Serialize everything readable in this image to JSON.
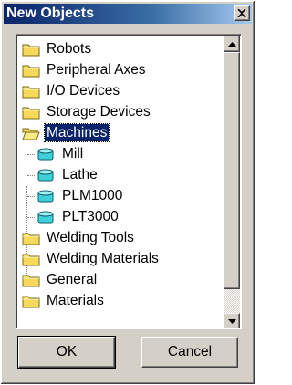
{
  "window": {
    "title": "New Objects"
  },
  "tree": {
    "items": [
      {
        "label": "Robots",
        "icon": "folder-icon"
      },
      {
        "label": "Peripheral Axes",
        "icon": "folder-icon"
      },
      {
        "label": "I/O Devices",
        "icon": "folder-icon"
      },
      {
        "label": "Storage Devices",
        "icon": "folder-icon"
      },
      {
        "label": "Machines",
        "icon": "open-folder-icon",
        "selected": true,
        "expanded": true
      },
      {
        "label": "Mill",
        "icon": "machine-icon",
        "child": true
      },
      {
        "label": "Lathe",
        "icon": "machine-icon",
        "child": true
      },
      {
        "label": "PLM1000",
        "icon": "machine-icon",
        "child": true
      },
      {
        "label": "PLT3000",
        "icon": "machine-icon",
        "child": true
      },
      {
        "label": "Welding Tools",
        "icon": "folder-icon"
      },
      {
        "label": "Welding Materials",
        "icon": "folder-icon"
      },
      {
        "label": "General",
        "icon": "folder-icon"
      },
      {
        "label": "Materials",
        "icon": "folder-icon"
      }
    ]
  },
  "buttons": {
    "ok": "OK",
    "cancel": "Cancel"
  },
  "colors": {
    "titlebar": "#0a246a",
    "face": "#d4d0c8",
    "selection": "#0a246a",
    "folder": "#f6d95a",
    "machine": "#3fd1d9"
  }
}
